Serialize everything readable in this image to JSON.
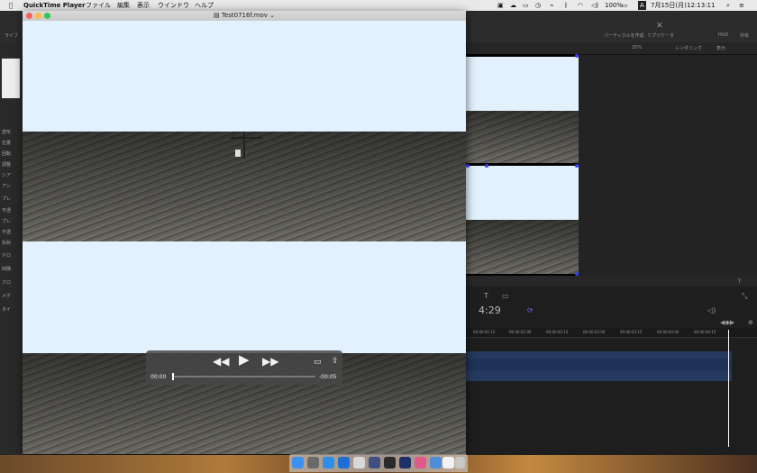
{
  "menubar": {
    "apple": "",
    "app_name": "QuickTime Player",
    "menus": [
      "ファイル",
      "編集",
      "表示",
      "ウインドウ",
      "ヘルプ"
    ],
    "battery": "100%",
    "input_mode": "A",
    "date": "7月15日(月)",
    "time": "12:13:11"
  },
  "background_app": {
    "toolbar_labels": [
      "パーティクルを作成",
      "リプリケータ",
      "HUD",
      "共有"
    ],
    "left_fragment": "ライブ",
    "zoom": "25%",
    "rendering": "レンダリング",
    "view": "表示",
    "inspector_rows": [
      "変形",
      "位置",
      "回転",
      "調整",
      "シア",
      "アン",
      "プレ",
      "不透",
      "プレ",
      "不透",
      "反射",
      "ドロ",
      "四隅",
      "クロ",
      "メデ",
      "タイ"
    ],
    "timecode": "4:29",
    "ruler": [
      "00:00:01:15",
      "00:00:02:00",
      "00:00:02:15",
      "00:00:03:00",
      "00:00:03:15",
      "00:00:04:00",
      "00:00:04:15"
    ]
  },
  "quicktime": {
    "title": "Test0716f.mov",
    "current_time": "00:00",
    "remaining_time": "-00:05",
    "progress": 0.0
  },
  "colors": {
    "sky": "#e2f1fd",
    "hud": "#464646",
    "track": "#26395f",
    "handle": "#3a3aff"
  }
}
